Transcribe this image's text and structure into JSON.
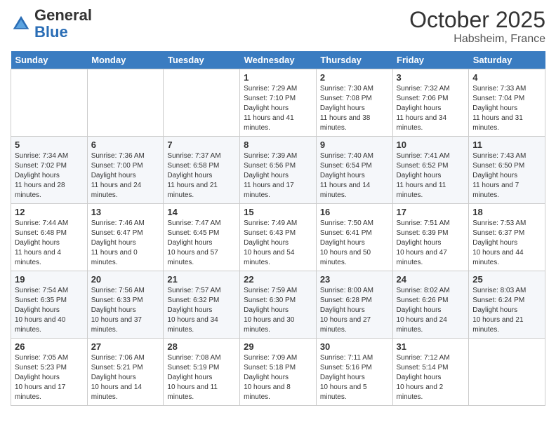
{
  "header": {
    "logo_line1": "General",
    "logo_line2": "Blue",
    "month_year": "October 2025",
    "location": "Habsheim, France"
  },
  "weekdays": [
    "Sunday",
    "Monday",
    "Tuesday",
    "Wednesday",
    "Thursday",
    "Friday",
    "Saturday"
  ],
  "weeks": [
    [
      {
        "day": "",
        "empty": true
      },
      {
        "day": "",
        "empty": true
      },
      {
        "day": "",
        "empty": true
      },
      {
        "day": "1",
        "sunrise": "7:29 AM",
        "sunset": "7:10 PM",
        "daylight": "11 hours and 41 minutes."
      },
      {
        "day": "2",
        "sunrise": "7:30 AM",
        "sunset": "7:08 PM",
        "daylight": "11 hours and 38 minutes."
      },
      {
        "day": "3",
        "sunrise": "7:32 AM",
        "sunset": "7:06 PM",
        "daylight": "11 hours and 34 minutes."
      },
      {
        "day": "4",
        "sunrise": "7:33 AM",
        "sunset": "7:04 PM",
        "daylight": "11 hours and 31 minutes."
      }
    ],
    [
      {
        "day": "5",
        "sunrise": "7:34 AM",
        "sunset": "7:02 PM",
        "daylight": "11 hours and 28 minutes."
      },
      {
        "day": "6",
        "sunrise": "7:36 AM",
        "sunset": "7:00 PM",
        "daylight": "11 hours and 24 minutes."
      },
      {
        "day": "7",
        "sunrise": "7:37 AM",
        "sunset": "6:58 PM",
        "daylight": "11 hours and 21 minutes."
      },
      {
        "day": "8",
        "sunrise": "7:39 AM",
        "sunset": "6:56 PM",
        "daylight": "11 hours and 17 minutes."
      },
      {
        "day": "9",
        "sunrise": "7:40 AM",
        "sunset": "6:54 PM",
        "daylight": "11 hours and 14 minutes."
      },
      {
        "day": "10",
        "sunrise": "7:41 AM",
        "sunset": "6:52 PM",
        "daylight": "11 hours and 11 minutes."
      },
      {
        "day": "11",
        "sunrise": "7:43 AM",
        "sunset": "6:50 PM",
        "daylight": "11 hours and 7 minutes."
      }
    ],
    [
      {
        "day": "12",
        "sunrise": "7:44 AM",
        "sunset": "6:48 PM",
        "daylight": "11 hours and 4 minutes."
      },
      {
        "day": "13",
        "sunrise": "7:46 AM",
        "sunset": "6:47 PM",
        "daylight": "11 hours and 0 minutes."
      },
      {
        "day": "14",
        "sunrise": "7:47 AM",
        "sunset": "6:45 PM",
        "daylight": "10 hours and 57 minutes."
      },
      {
        "day": "15",
        "sunrise": "7:49 AM",
        "sunset": "6:43 PM",
        "daylight": "10 hours and 54 minutes."
      },
      {
        "day": "16",
        "sunrise": "7:50 AM",
        "sunset": "6:41 PM",
        "daylight": "10 hours and 50 minutes."
      },
      {
        "day": "17",
        "sunrise": "7:51 AM",
        "sunset": "6:39 PM",
        "daylight": "10 hours and 47 minutes."
      },
      {
        "day": "18",
        "sunrise": "7:53 AM",
        "sunset": "6:37 PM",
        "daylight": "10 hours and 44 minutes."
      }
    ],
    [
      {
        "day": "19",
        "sunrise": "7:54 AM",
        "sunset": "6:35 PM",
        "daylight": "10 hours and 40 minutes."
      },
      {
        "day": "20",
        "sunrise": "7:56 AM",
        "sunset": "6:33 PM",
        "daylight": "10 hours and 37 minutes."
      },
      {
        "day": "21",
        "sunrise": "7:57 AM",
        "sunset": "6:32 PM",
        "daylight": "10 hours and 34 minutes."
      },
      {
        "day": "22",
        "sunrise": "7:59 AM",
        "sunset": "6:30 PM",
        "daylight": "10 hours and 30 minutes."
      },
      {
        "day": "23",
        "sunrise": "8:00 AM",
        "sunset": "6:28 PM",
        "daylight": "10 hours and 27 minutes."
      },
      {
        "day": "24",
        "sunrise": "8:02 AM",
        "sunset": "6:26 PM",
        "daylight": "10 hours and 24 minutes."
      },
      {
        "day": "25",
        "sunrise": "8:03 AM",
        "sunset": "6:24 PM",
        "daylight": "10 hours and 21 minutes."
      }
    ],
    [
      {
        "day": "26",
        "sunrise": "7:05 AM",
        "sunset": "5:23 PM",
        "daylight": "10 hours and 17 minutes."
      },
      {
        "day": "27",
        "sunrise": "7:06 AM",
        "sunset": "5:21 PM",
        "daylight": "10 hours and 14 minutes."
      },
      {
        "day": "28",
        "sunrise": "7:08 AM",
        "sunset": "5:19 PM",
        "daylight": "10 hours and 11 minutes."
      },
      {
        "day": "29",
        "sunrise": "7:09 AM",
        "sunset": "5:18 PM",
        "daylight": "10 hours and 8 minutes."
      },
      {
        "day": "30",
        "sunrise": "7:11 AM",
        "sunset": "5:16 PM",
        "daylight": "10 hours and 5 minutes."
      },
      {
        "day": "31",
        "sunrise": "7:12 AM",
        "sunset": "5:14 PM",
        "daylight": "10 hours and 2 minutes."
      },
      {
        "day": "",
        "empty": true
      }
    ]
  ]
}
